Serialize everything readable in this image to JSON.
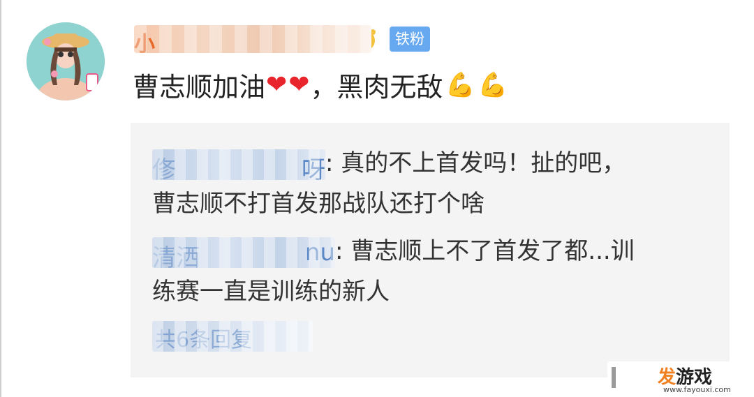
{
  "comment": {
    "username": "小",
    "badge": "铁粉",
    "text_before": "曹志顺加油",
    "hearts": [
      "❤",
      "❤"
    ],
    "text_after": "，黑肉无敌",
    "muscle_emoji": [
      "💪",
      "💪"
    ]
  },
  "replies": [
    {
      "user_head": "俢",
      "user_tail": "呀",
      "line1": ": 真的不上首发吗！扯的吧，",
      "line2": "曹志顺不打首发那战队还打个啥"
    },
    {
      "user_head": "清洒",
      "user_tail": "nu",
      "line1": ": 曹志顺上不了首发了都...训",
      "line2": "练赛一直是训练的新人"
    }
  ],
  "view_more_text": "共6条回复",
  "watermark": {
    "logo_accent": "发",
    "logo_rest": "游戏",
    "url": "www.fayouxi.com"
  },
  "colors": {
    "badge_bg": "#66a9f0",
    "heart": "#e8242c",
    "reply_bg": "#f4f4f4",
    "username_link": "#5b87c4"
  }
}
